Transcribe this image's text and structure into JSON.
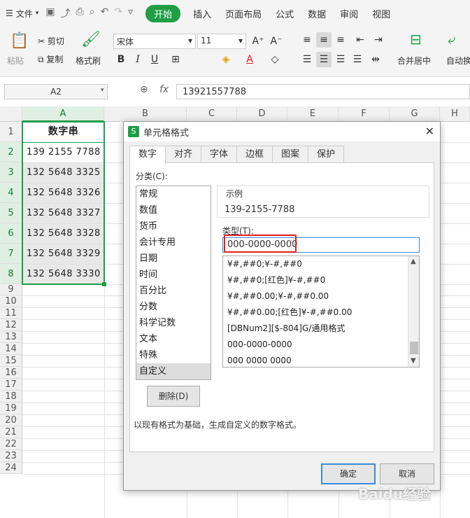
{
  "menubar": {
    "file_label": "文件",
    "tabs": [
      "开始",
      "插入",
      "页面布局",
      "公式",
      "数据",
      "审阅",
      "视图"
    ]
  },
  "ribbon": {
    "paste": "粘贴",
    "cut": "剪切",
    "copy": "复制",
    "format_painter": "格式刷",
    "font_name": "宋体",
    "font_size": "11",
    "merge": "合并居中",
    "wrap": "自动换"
  },
  "formula_bar": {
    "name_box": "A2",
    "fx": "fx",
    "value": "13921557788"
  },
  "columns": [
    "A",
    "B",
    "C",
    "D",
    "E",
    "F",
    "G",
    "H"
  ],
  "rows": [
    "1",
    "2",
    "3",
    "4",
    "5",
    "6",
    "7",
    "8",
    "9",
    "10",
    "11",
    "12",
    "13",
    "14",
    "15",
    "16",
    "17",
    "18",
    "19",
    "20",
    "21",
    "22",
    "23",
    "24"
  ],
  "cells": {
    "header": "数字串",
    "values": [
      "139  2155  7788",
      "132  5648  3325",
      "132  5648  3326",
      "132  5648  3327",
      "132  5648  3328",
      "132  5648  3329",
      "132  5648  3330"
    ]
  },
  "dialog": {
    "title": "单元格格式",
    "tabs": [
      "数字",
      "对齐",
      "字体",
      "边框",
      "图案",
      "保护"
    ],
    "category_label": "分类(C):",
    "categories": [
      "常规",
      "数值",
      "货币",
      "会计专用",
      "日期",
      "时间",
      "百分比",
      "分数",
      "科学记数",
      "文本",
      "特殊",
      "自定义"
    ],
    "selected_category": "自定义",
    "sample_label": "示例",
    "sample_value": "139-2155-7788",
    "type_label": "类型(T):",
    "type_value": "000-0000-0000",
    "formats": [
      "¥#,##0;¥-#,##0",
      "¥#,##0;[红色]¥-#,##0",
      "¥#,##0.00;¥-#,##0.00",
      "¥#,##0.00;[红色]¥-#,##0.00",
      "[DBNum2][$-804]G/通用格式",
      "000-0000-0000",
      "000 0000 0000"
    ],
    "delete_button": "删除(D)",
    "note": "以现有格式为基础，生成自定义的数字格式。",
    "ok_button": "确定",
    "cancel_button": "取消"
  },
  "watermark": "Baidu经验"
}
